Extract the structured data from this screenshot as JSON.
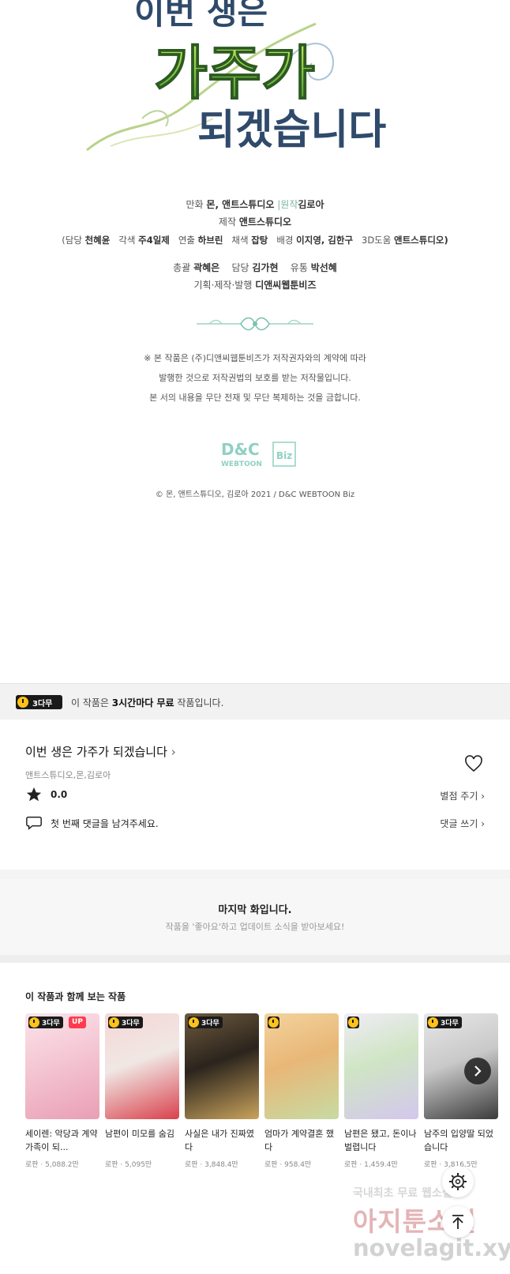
{
  "credits": {
    "title_lines": [
      "이번 생은",
      "가주가",
      "되겠습니다"
    ],
    "line1": {
      "manhwa_label": "만화",
      "manhwa_value": "몬, 앤트스튜디오",
      "original_label": "|원작",
      "original_value": "김로아"
    },
    "line2": {
      "prod_label": "제작",
      "prod_value": "앤트스튜디오"
    },
    "line3": {
      "open": "(담당",
      "staff1": "천혜윤",
      "coloring_label": "각색",
      "coloring_value": "주4일제",
      "direct_label": "연출",
      "direct_value": "하브린",
      "paint_label": "채색",
      "paint_value": "잡탕",
      "bg_label": "배경",
      "bg_value": "이지영, 김한구",
      "d3_label": "3D도움",
      "d3_value": "앤트스튜디오)"
    },
    "line4": {
      "gen_label": "총괄",
      "gen_value": "곽혜은",
      "charge_label": "담당",
      "charge_value": "김가현",
      "dist_label": "유통",
      "dist_value": "박선혜"
    },
    "line5": {
      "plan_label": "기획·제작·발행",
      "plan_value": "디앤씨웹툰비즈"
    },
    "notice": [
      "※ 본 작품은 (주)디앤씨웹툰비즈가 저작권자와의 계약에 따라",
      "발행한 것으로 저작권법의 보호를 받는 저작물입니다.",
      "본 서의 내용을 무단 전재 및 무단 복제하는 것을 금합니다."
    ],
    "logo_top": "D&C",
    "logo_bottom": "WEBTOON",
    "logo_biz": "Biz",
    "copyright": "© 몬, 앤트스튜디오, 김로아 2021 / D&C WEBTOON Biz"
  },
  "free_banner": {
    "badge": "3다무",
    "text_pre": "이 작품은 ",
    "text_bold": "3시간마다 무료",
    "text_post": " 작품입니다."
  },
  "work": {
    "title": "이번 생은 가주가 되겠습니다",
    "chevron": "›",
    "authors": "앤트스튜디오,몬,김로아",
    "rating": "0.0",
    "rate_action": "별점 주기 ›",
    "comment_prompt": "첫 번째 댓글을 남겨주세요.",
    "comment_action": "댓글 쓰기 ›"
  },
  "last_episode": {
    "heading": "마지막 화입니다.",
    "sub": "작품을 '좋아요'하고 업데이트 소식을 받아보세요!"
  },
  "recommendations": {
    "heading": "이 작품과 함께 보는 작품",
    "items": [
      {
        "badge": "3다무",
        "up": "UP",
        "title": "세이렌: 악당과 계약가족이 되...",
        "genre": "로판",
        "views": "5,088.2만",
        "colors": [
          "#f4c6d3",
          "#e99fb4",
          "#fbe3ea"
        ]
      },
      {
        "badge": "3다무",
        "up": "",
        "title": "남편이 미모를 숨김",
        "genre": "로판",
        "views": "5,095만",
        "colors": [
          "#f0e7e4",
          "#d9414c",
          "#f5d7d5"
        ]
      },
      {
        "badge": "3다무",
        "up": "",
        "title": "사실은 내가 진짜였다",
        "genre": "로판",
        "views": "3,848.4만",
        "colors": [
          "#2b241d",
          "#c9a35c",
          "#6d5a3d"
        ]
      },
      {
        "badge": "",
        "up": "",
        "title": "엄마가 계약결혼 했다",
        "genre": "로판",
        "views": "958.4만",
        "colors": [
          "#e8b777",
          "#c7dba3",
          "#f3d39d"
        ]
      },
      {
        "badge": "",
        "up": "",
        "title": "남편은 됐고, 돈이나 벌렵니다",
        "genre": "로판",
        "views": "1,459.4만",
        "colors": [
          "#cfe5c4",
          "#d4c7ee",
          "#f1ecf7"
        ]
      },
      {
        "badge": "3다무",
        "up": "",
        "title": "남주의 입양딸 되었습니다",
        "genre": "로판",
        "views": "3,816.5만",
        "colors": [
          "#c9c9c9",
          "#3b3b3b",
          "#e7e7e7"
        ]
      }
    ]
  },
  "watermark": {
    "line1": "국내최초 무료 웹소설",
    "line2": "아지툰소설",
    "line3": "novelagit.xyz"
  }
}
